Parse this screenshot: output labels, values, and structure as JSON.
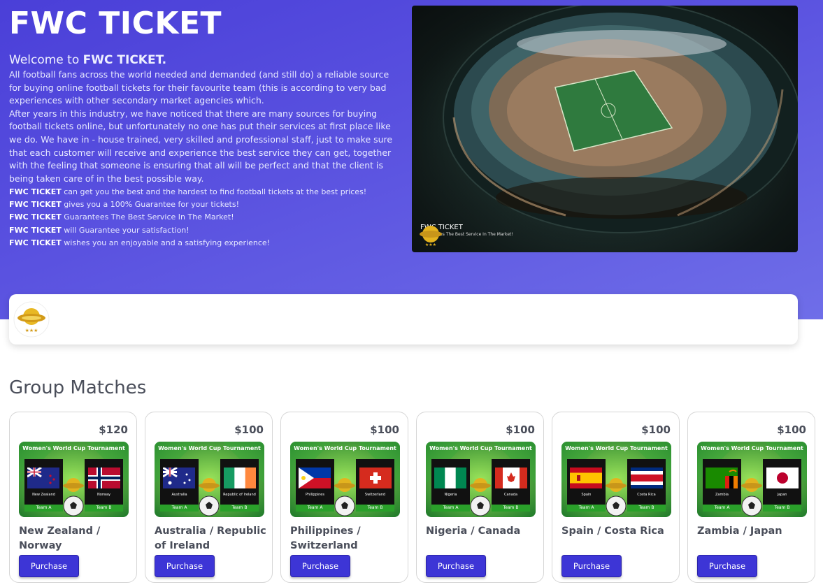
{
  "hero": {
    "title": "FWC TICKET",
    "welcome_prefix": "Welcome to ",
    "welcome_brand": "FWC TICKET.",
    "paragraph": "All football fans across the world needed and demanded (and still do) a reliable source for buying online football tickets for their favourite team (this is according to very bad experiences with other secondary market agencies which.\nAfter years in this industry, we have noticed that there are many sources for buying football tickets online, but unfortunately no one has put their services at first place like we do. We have in - house trained, very skilled and professional staff, just to make sure that each customer will receive and experience the best service they can get, together with the feeling that someone is ensuring that all will be perfect and that the client is being taken care of in the best possible way.",
    "bullets": [
      {
        "brand": "FWC TICKET",
        "text": " can get you the best and the hardest to find football tickets at the best prices!"
      },
      {
        "brand": "FWC TICKET",
        "text": " gives you a 100% Guarantee for your tickets!"
      },
      {
        "brand": "FWC TICKET",
        "text": " Guarantees The Best Service In The Market!"
      },
      {
        "brand": "FWC TICKET",
        "text": " will Guarantee your satisfaction!"
      },
      {
        "brand": "FWC TICKET",
        "text": " wishes you an enjoyable and a satisfying experience!"
      }
    ],
    "image_brand": "FWC TICKET",
    "image_tagline": "Guarantees The Best Service In The Market!"
  },
  "section_title": "Group Matches",
  "poster_heading": "Women's World Cup Tournament",
  "poster_team_a": "Team A",
  "poster_team_b": "Team B",
  "purchase_label": "Purchase",
  "colors": {
    "accent": "#3d35d6",
    "hero_start": "#4a3fd8",
    "hero_end": "#6f6ee8"
  },
  "matches": [
    {
      "price": "$120",
      "title": "New Zealand / Norway",
      "team1": "New Zealand",
      "team2": "Norway",
      "flag1": "nz",
      "flag2": "no"
    },
    {
      "price": "$100",
      "title": "Australia / Republic of Ireland",
      "team1": "Australia",
      "team2": "Republic of Ireland",
      "flag1": "au",
      "flag2": "ie"
    },
    {
      "price": "$100",
      "title": "Philippines / Switzerland",
      "team1": "Philippines",
      "team2": "Switzerland",
      "flag1": "ph",
      "flag2": "ch"
    },
    {
      "price": "$100",
      "title": "Nigeria / Canada",
      "team1": "Nigeria",
      "team2": "Canada",
      "flag1": "ng",
      "flag2": "ca"
    },
    {
      "price": "$100",
      "title": "Spain / Costa Rica",
      "team1": "Spain",
      "team2": "Costa Rica",
      "flag1": "es",
      "flag2": "cr"
    },
    {
      "price": "$100",
      "title": "Zambia / Japan",
      "team1": "Zambia",
      "team2": "Japan",
      "flag1": "zm",
      "flag2": "jp"
    }
  ]
}
